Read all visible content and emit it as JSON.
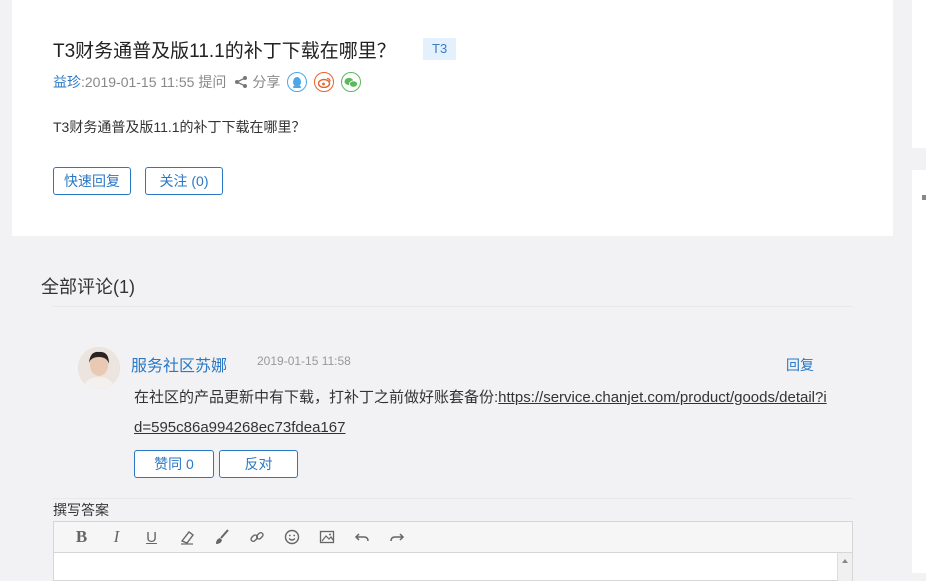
{
  "question": {
    "title": "T3财务通普及版11.1的补丁下载在哪里？",
    "tag": "T3",
    "author": "益珍",
    "meta_sep": " : ",
    "time": "2019-01-15 11:55",
    "action": "提问",
    "share_label": "分享",
    "body": "T3财务通普及版11.1的补丁下载在哪里？",
    "quick_reply_label": "快速回复",
    "follow_label": "关注 (0)"
  },
  "comments": {
    "title": "全部评论(1)",
    "items": [
      {
        "user": "服务社区苏娜",
        "time": "2019-01-15 11:58",
        "reply_label": "回复",
        "text_prefix": "在社区的产品更新中有下载，打补丁之前做好账套备份:",
        "link": "https://service.chanjet.com/product/goods/detail?id=595c86a994268ec73fdea167",
        "agree_label": "赞同 0",
        "oppose_label": "反对"
      }
    ]
  },
  "editor": {
    "label": "撰写答案",
    "tools": [
      "bold-icon",
      "italic-icon",
      "underline-icon",
      "eraser-icon",
      "brush-icon",
      "link-icon",
      "emoji-icon",
      "image-icon",
      "undo-icon",
      "redo-icon"
    ]
  },
  "colors": {
    "accent": "#2a78c5",
    "tag_bg": "#e4f0fc",
    "qq": "#4aa8e8",
    "weibo": "#e8622a",
    "wechat": "#5cb85c"
  }
}
